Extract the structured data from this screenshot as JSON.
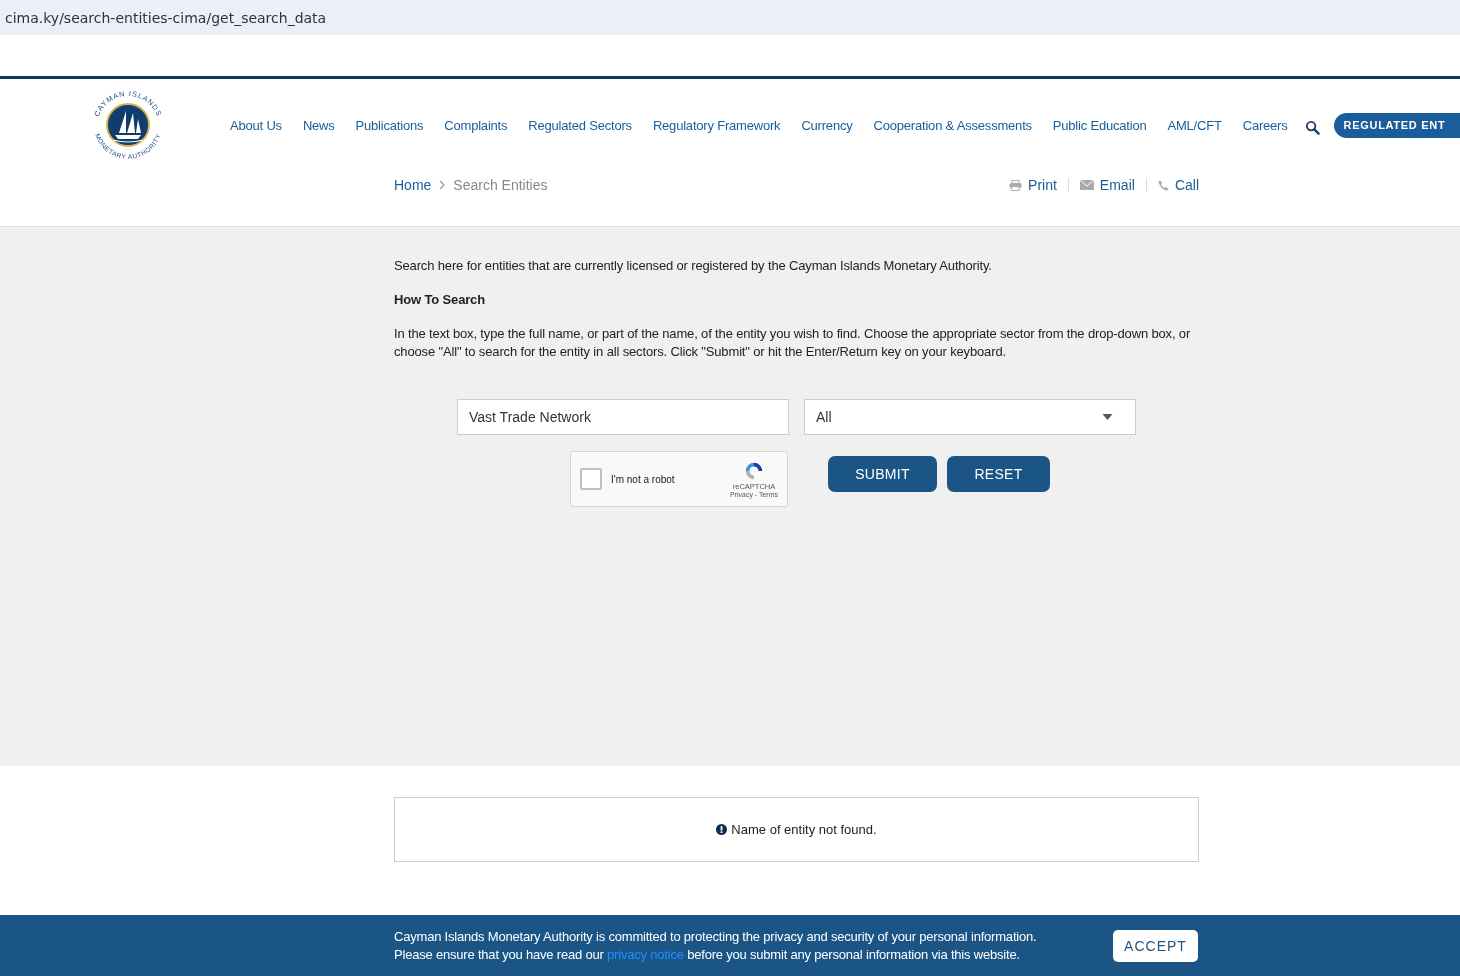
{
  "address_bar": {
    "url": "cima.ky/search-entities-cima/get_search_data"
  },
  "logo": {
    "top_text": "CAYMAN ISLANDS",
    "bottom_text": "MONETARY AUTHORITY"
  },
  "nav": {
    "items": [
      "About Us",
      "News",
      "Publications",
      "Complaints",
      "Regulated Sectors",
      "Regulatory Framework",
      "Currency",
      "Cooperation & Assessments",
      "Public Education",
      "AML/CFT",
      "Careers"
    ],
    "cta": "REGULATED ENT"
  },
  "breadcrumb": [
    "Home",
    "Search Entities"
  ],
  "actions": [
    {
      "kind": "print",
      "label": "Print"
    },
    {
      "kind": "email",
      "label": "Email"
    },
    {
      "kind": "call",
      "label": "Call"
    }
  ],
  "intro": "Search here for entities that are currently licensed or registered by the Cayman Islands Monetary Authority.",
  "how_to": {
    "heading": "How To Search",
    "text": "In the text box, type the full name, or part of the name, of the entity you wish to find. Choose the appropriate sector from the drop-down box, or choose \"All\" to search for the entity in all sectors. Click \"Submit\" or hit the Enter/Return key on your keyboard."
  },
  "search": {
    "value": "Vast Trade Network",
    "sector": "All"
  },
  "captcha": {
    "label": "I'm not a robot",
    "checked": false,
    "brand": "reCAPTCHA",
    "links": "Privacy - Terms"
  },
  "buttons": [
    "SUBMIT",
    "RESET"
  ],
  "result": {
    "message": "Name of entity not found."
  },
  "cookie_banner": {
    "line_1": "Cayman Islands Monetary Authority is committed to protecting the privacy and security of your personal information.",
    "line_2_before": "Please ensure that you have read our",
    "link": "privacy notice",
    "line_2_after": "before you submit any personal information via this website.",
    "button": "ACCEPT"
  }
}
